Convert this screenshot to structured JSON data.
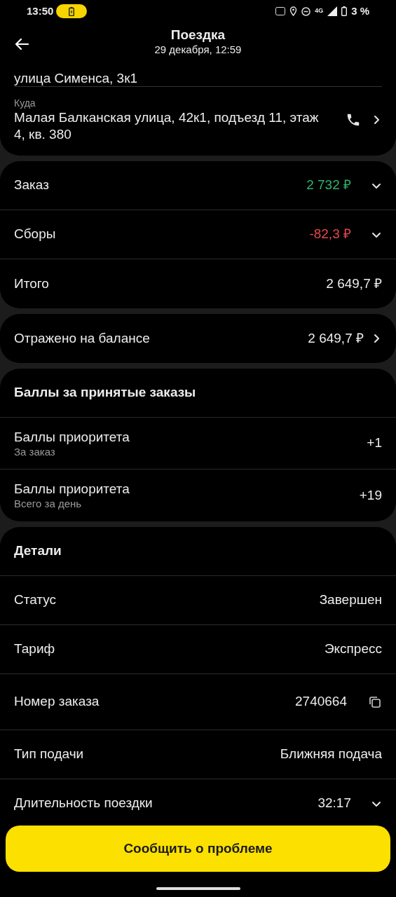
{
  "status_bar": {
    "time": "13:50",
    "battery": "3 %",
    "network": "4G"
  },
  "header": {
    "title": "Поездка",
    "subtitle": "29 декабря, 12:59"
  },
  "route": {
    "from_tail": "улица Сименса, 3к1",
    "to_label": "Куда",
    "to_address": "Малая Балканская улица, 42к1, подъезд 11, этаж 4, кв. 380"
  },
  "summary": [
    {
      "label": "Заказ",
      "value": "2 732 ₽",
      "color": "#2fb36b",
      "expandable": true
    },
    {
      "label": "Сборы",
      "value": "-82,3 ₽",
      "color": "#e5484d",
      "expandable": true
    },
    {
      "label": "Итого",
      "value": "2 649,7 ₽",
      "color": "#ececec",
      "expandable": false
    }
  ],
  "balance": {
    "label": "Отражено на балансе",
    "value": "2 649,7 ₽"
  },
  "points": {
    "title": "Баллы за принятые заказы",
    "rows": [
      {
        "label": "Баллы приоритета",
        "sublabel": "За заказ",
        "value": "+1"
      },
      {
        "label": "Баллы приоритета",
        "sublabel": "Всего за день",
        "value": "+19"
      }
    ]
  },
  "details": {
    "title": "Детали",
    "rows": [
      {
        "kind": "plain",
        "label": "Статус",
        "value": "Завершен"
      },
      {
        "kind": "plain",
        "label": "Тариф",
        "value": "Экспресс"
      },
      {
        "kind": "copy",
        "label": "Номер заказа",
        "value": "2740664"
      },
      {
        "kind": "plain",
        "label": "Тип подачи",
        "value": "Ближняя подача"
      },
      {
        "kind": "expandable",
        "label": "Длительность поездки",
        "value": "32:17"
      }
    ]
  },
  "action_button": "Сообщить о проблеме"
}
